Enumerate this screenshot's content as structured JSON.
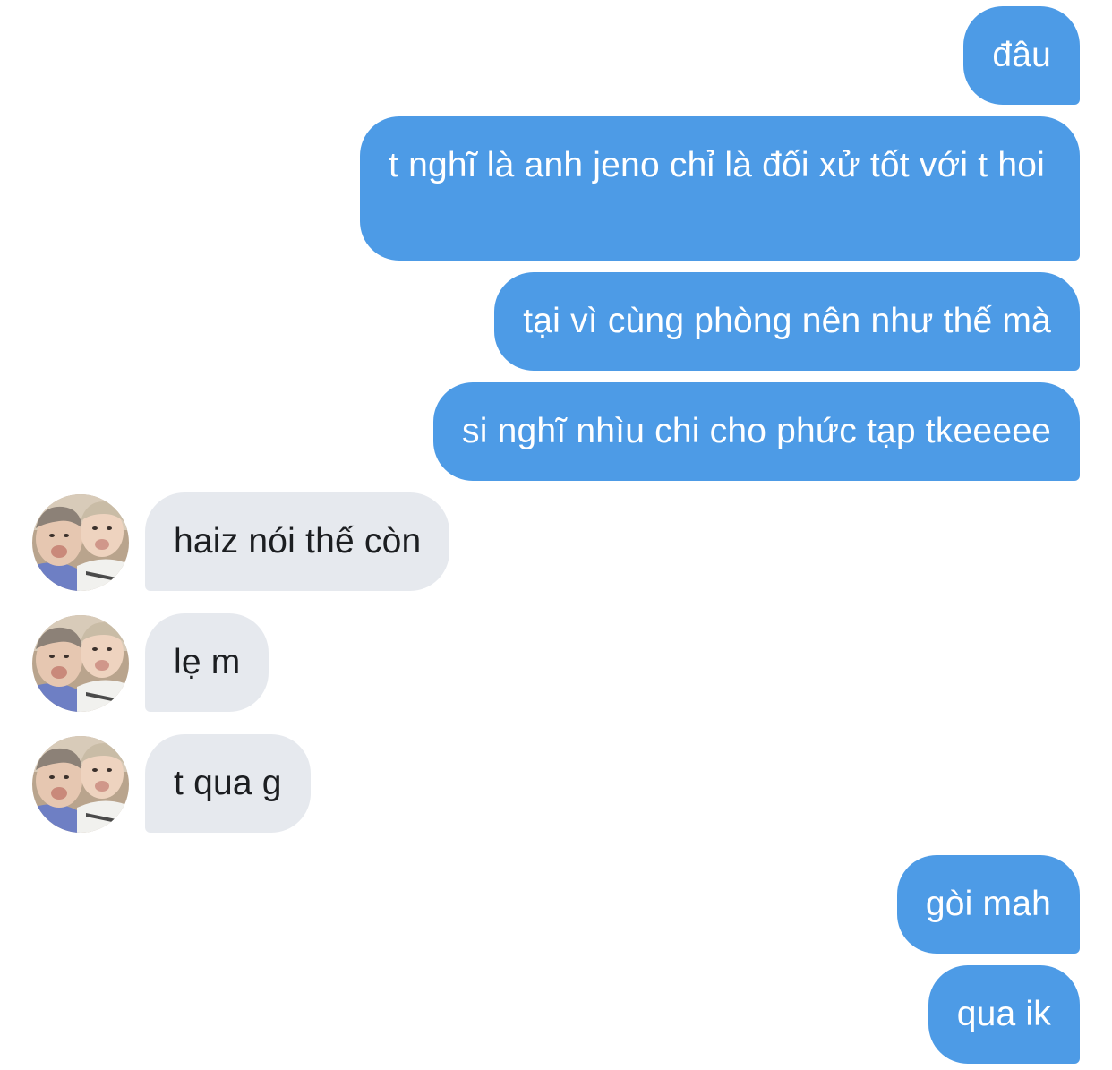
{
  "colors": {
    "sent_bubble": "#4d9be6",
    "received_bubble": "#e6e9ee",
    "received_text": "#1c1e21",
    "background": "#ffffff"
  },
  "contact": {
    "avatar_icon": "contact-photo-avatar"
  },
  "messages": [
    {
      "direction": "sent",
      "text": "đâu"
    },
    {
      "direction": "sent",
      "text": "t nghĩ là anh jeno chỉ là đối xử tốt với t hoi"
    },
    {
      "direction": "sent",
      "text": "tại vì cùng phòng nên như thế mà"
    },
    {
      "direction": "sent",
      "text": "si nghĩ nhìu chi cho phức tạp tkeeeee"
    },
    {
      "direction": "received",
      "text": "haiz nói thế còn"
    },
    {
      "direction": "received",
      "text": "lẹ m"
    },
    {
      "direction": "received",
      "text": "t qua g"
    },
    {
      "direction": "sent",
      "text": "gòi mah"
    },
    {
      "direction": "sent",
      "text": "qua ik"
    }
  ]
}
